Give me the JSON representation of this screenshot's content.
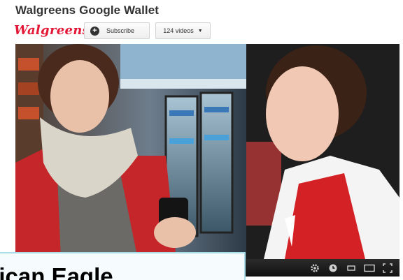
{
  "channel": {
    "title": "Walgreens Google Wallet",
    "logo_text": "Walgreens",
    "subscribe_label": "Subscribe",
    "videos_label": "124 videos"
  },
  "player": {
    "controls": [
      "gear-icon",
      "clock-icon",
      "small-player-icon",
      "large-player-icon",
      "fullscreen-icon"
    ]
  },
  "overlay": {
    "text": "American Eagle"
  },
  "colors": {
    "brand_red": "#e31837",
    "overlay_border": "#a9dde8"
  }
}
